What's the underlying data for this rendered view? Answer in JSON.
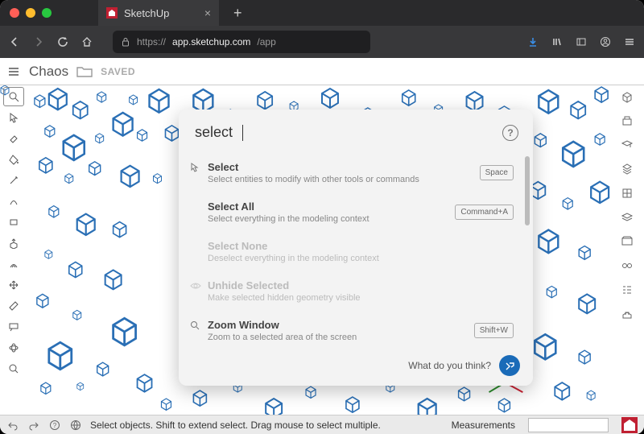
{
  "window": {
    "app_name": "SketchUp"
  },
  "browser": {
    "url": "https://app.sketchup.com/app",
    "url_domain": "app.sketchup.com",
    "url_path": "/app"
  },
  "sketchup": {
    "menu_button": "≡",
    "project_title": "Chaos",
    "saved_label": "SAVED"
  },
  "search": {
    "query": "select",
    "help_tooltip": "?",
    "feedback_label": "What do you think?",
    "results": [
      {
        "title": "Select",
        "desc": "Select entities to modify with other tools or commands",
        "shortcut": "Space",
        "enabled": true,
        "icon": "pointer"
      },
      {
        "title": "Select All",
        "desc": "Select everything in the modeling context",
        "shortcut": "Command+A",
        "enabled": true,
        "icon": ""
      },
      {
        "title": "Select None",
        "desc": "Deselect everything in the modeling context",
        "shortcut": "",
        "enabled": false,
        "icon": ""
      },
      {
        "title": "Unhide Selected",
        "desc": "Make selected hidden geometry visible",
        "shortcut": "",
        "enabled": false,
        "icon": "unhide"
      },
      {
        "title": "Zoom Window",
        "desc": "Zoom to a selected area of the screen",
        "shortcut": "Shift+W",
        "enabled": true,
        "icon": "zoom"
      }
    ]
  },
  "status": {
    "hint": "Select objects. Shift to extend select. Drag mouse to select multiple.",
    "measurements_label": "Measurements"
  }
}
